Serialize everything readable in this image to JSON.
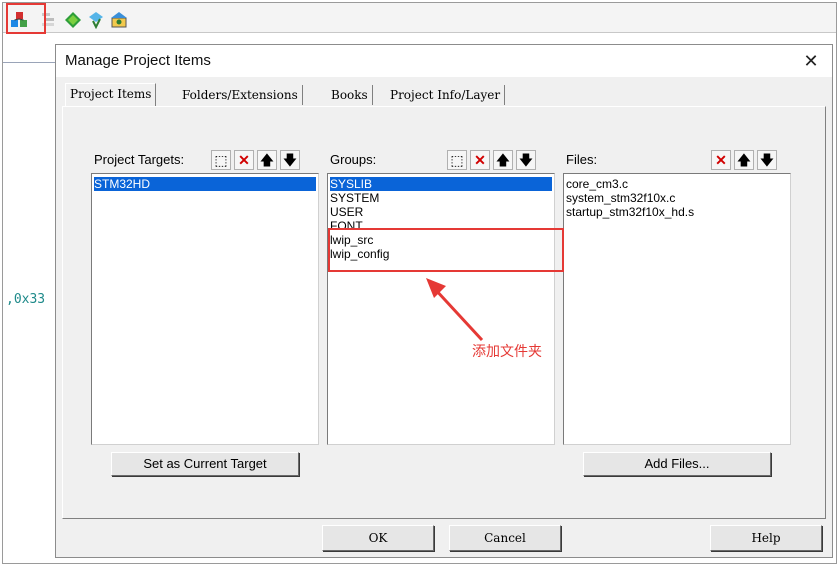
{
  "toolbar": {
    "icons": [
      "manage-project-items-icon",
      "pages-icon",
      "green-diamond-icon",
      "options-icon",
      "translate-icon"
    ]
  },
  "editor": {
    "code_fragment": ",0x33"
  },
  "dialog": {
    "title": "Manage Project Items",
    "close_glyph": "✕",
    "tabs": [
      {
        "label": "Project Items"
      },
      {
        "label": "Folders/Extensions"
      },
      {
        "label": "Books"
      },
      {
        "label": "Project Info/Layer"
      }
    ],
    "targets": {
      "label": "Project Targets:",
      "items": [
        "STM32HD"
      ]
    },
    "groups": {
      "label": "Groups:",
      "items": [
        "SYSLIB",
        "SYSTEM",
        "USER",
        "FONT",
        "lwip_src",
        "lwip_config"
      ]
    },
    "files": {
      "label": "Files:",
      "items": [
        "core_cm3.c",
        "system_stm32f10x.c",
        "startup_stm32f10x_hd.s"
      ]
    },
    "buttons": {
      "set_current": "Set as Current Target",
      "add_files": "Add Files...",
      "ok": "OK",
      "cancel": "Cancel",
      "help": "Help"
    },
    "header_glyphs": {
      "new": "⬚",
      "delete": "✕",
      "up": "🡅",
      "down": "🡇"
    }
  },
  "annotation": {
    "text": "添加文件夹",
    "color": "#e53935"
  }
}
